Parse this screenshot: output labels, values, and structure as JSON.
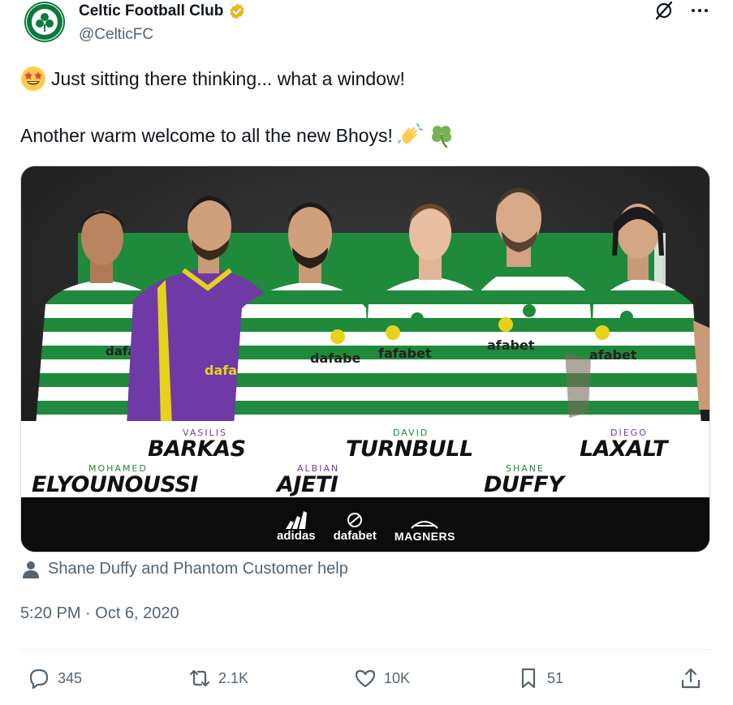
{
  "account": {
    "display_name": "Celtic Football Club",
    "handle": "@CelticFC",
    "verified": true,
    "badge_color": "#e8b923"
  },
  "header_icons": [
    "grok-icon",
    "more-icon"
  ],
  "tweet": {
    "line1": "Just sitting there thinking... what a window!",
    "line2": "Another warm welcome to all the new Bhoys!",
    "emojis": [
      "star-struck-emoji",
      "waving-hands-emoji",
      "shamrock-emoji"
    ]
  },
  "media": {
    "players": [
      {
        "first": "MOHAMED",
        "last": "ELYOUNOUSSI"
      },
      {
        "first": "VASILIS",
        "last": "BARKAS"
      },
      {
        "first": "ALBIAN",
        "last": "AJETI"
      },
      {
        "first": "DAVID",
        "last": "TURNBULL"
      },
      {
        "first": "SHANE",
        "last": "DUFFY"
      },
      {
        "first": "DIEGO",
        "last": "LAXALT"
      }
    ],
    "kit_sponsor": "dafabet",
    "sponsors": [
      "adidas",
      "dafabet",
      "MAGNERS"
    ],
    "colors": {
      "celtic_green": "#1f8a3b",
      "goalkeeper_purple": "#6f3aa6",
      "yellow_accent": "#e6d21a"
    }
  },
  "tagged": {
    "icon": "person-icon",
    "text": "Shane Duffy and Phantom Customer help"
  },
  "timestamp": "5:20 PM · Oct 6, 2020",
  "actions": {
    "replies": "345",
    "reposts": "2.1K",
    "likes": "10K",
    "bookmarks": "51"
  }
}
